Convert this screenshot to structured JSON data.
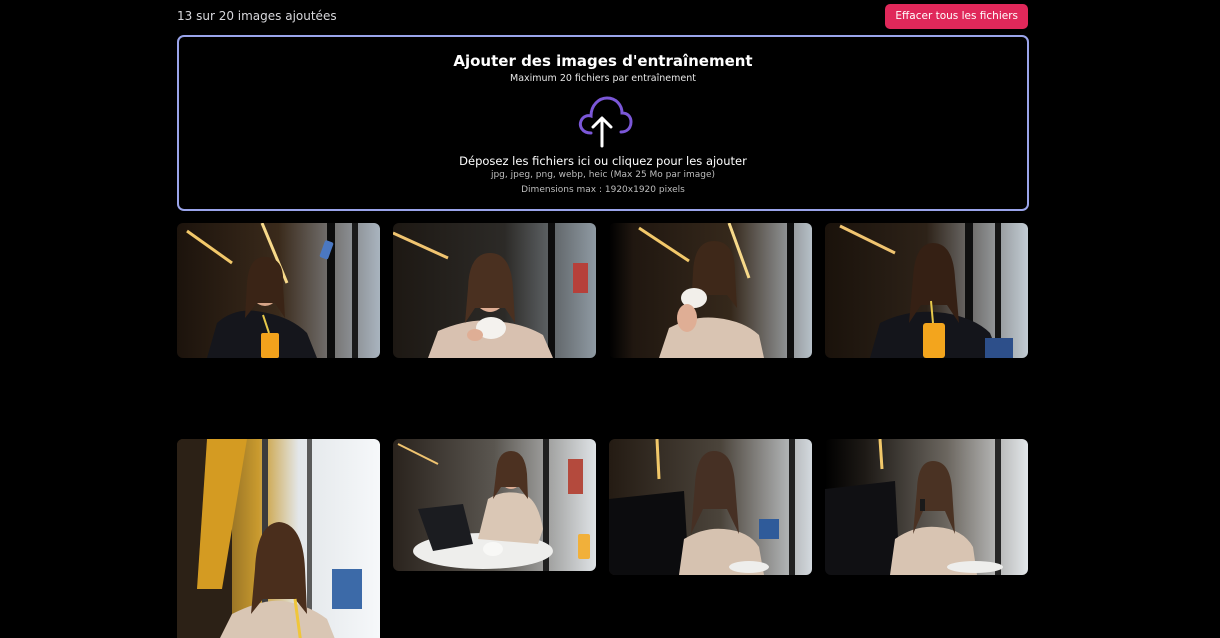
{
  "header": {
    "count_label": "13 sur 20 images ajoutées",
    "clear_button": "Effacer tous les fichiers"
  },
  "upload": {
    "title": "Ajouter des images d'entraînement",
    "subtitle": "Maximum 20 fichiers par entraînement",
    "icon": "cloud-upload-icon",
    "instruction": "Déposez les fichiers ici ou cliquez pour les ajouter",
    "formats": "jpg, jpeg, png, webp, heic (Max 25 Mo par image)",
    "dimensions": "Dimensions max : 1920x1920 pixels"
  },
  "colors": {
    "background": "#000000",
    "accent_button": "#e0285a",
    "dropzone_border": "#9aa4ea",
    "icon_cloud": "#7b57d8"
  },
  "images": [
    {
      "name": "image-1",
      "scene": "selfie-orange-juice"
    },
    {
      "name": "image-2",
      "scene": "coffee-cup-window"
    },
    {
      "name": "image-3",
      "scene": "coffee-cup-holding"
    },
    {
      "name": "image-4",
      "scene": "straw-orange-juice"
    },
    {
      "name": "image-5",
      "scene": "portrait-straw-window"
    },
    {
      "name": "image-6",
      "scene": "laptop-table"
    },
    {
      "name": "image-7",
      "scene": "phone-call-laptop"
    },
    {
      "name": "image-8",
      "scene": "phone-call-window"
    }
  ]
}
